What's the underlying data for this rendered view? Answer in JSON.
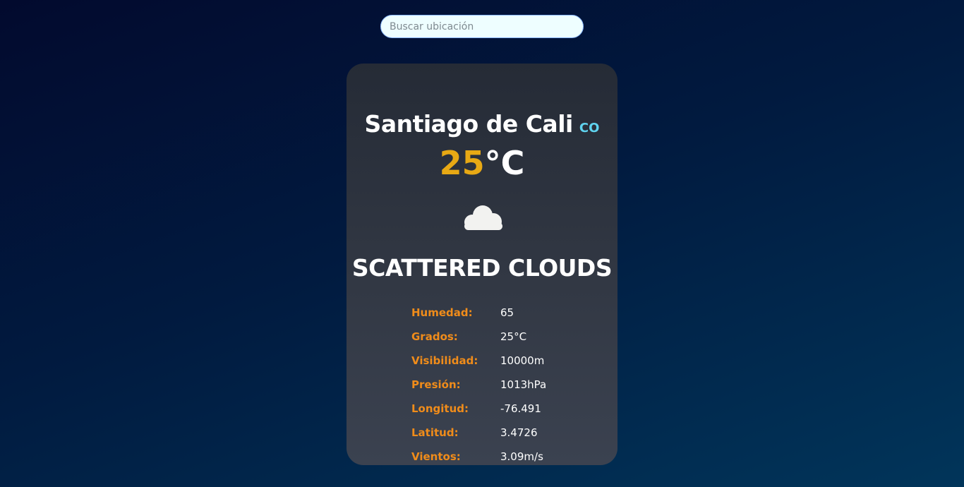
{
  "search": {
    "placeholder": "Buscar ubicación",
    "value": ""
  },
  "weather": {
    "city": "Santiago de Cali",
    "country": "CO",
    "temperature": "25",
    "temperature_unit": "°C",
    "icon": "cloud-icon",
    "description": "SCATTERED CLOUDS",
    "details": [
      {
        "label": "Humedad:",
        "value": "65"
      },
      {
        "label": "Grados:",
        "value": "25°C"
      },
      {
        "label": "Visibilidad:",
        "value": "10000m"
      },
      {
        "label": "Presión:",
        "value": "1013hPa"
      },
      {
        "label": "Longitud:",
        "value": "-76.491"
      },
      {
        "label": "Latitud:",
        "value": "3.4726"
      },
      {
        "label": "Vientos:",
        "value": "3.09m/s"
      }
    ]
  },
  "colors": {
    "accent_temp": "#e8a914",
    "label_orange": "#f08c1a",
    "country_cyan": "#5fd3ef",
    "card_bg": "#2b313c",
    "search_bg": "#eefeff"
  }
}
